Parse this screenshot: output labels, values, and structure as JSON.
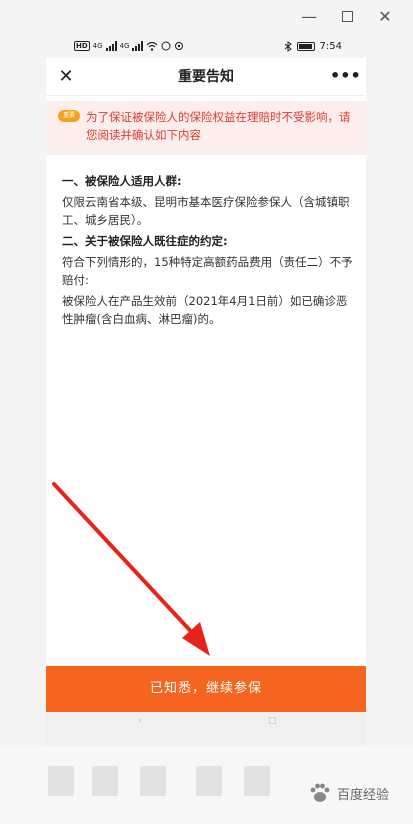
{
  "window": {
    "minimize_glyph": "—",
    "close_glyph": "✕"
  },
  "status_bar": {
    "network_badge": "HD",
    "signal_label_1": "4G",
    "signal_label_2": "4G",
    "time": "7:54"
  },
  "nav": {
    "title": "重要告知",
    "close_glyph": "✕",
    "more_glyph": "•••"
  },
  "notice": {
    "badge": "重要",
    "text": "为了保证被保险人的保险权益在理赔时不受影响，请您阅读并确认如下内容"
  },
  "content": {
    "section1_heading": "一、被保险人适用人群:",
    "section1_body": "仅限云南省本级、昆明市基本医疗保险参保人（含城镇职工、城乡居民）。",
    "section2_heading": "二、关于被保险人既往症的约定:",
    "section2_body1": "符合下列情形的，15种特定高额药品费用（责任二）不予赔付:",
    "section2_body2": "被保险人在产品生效前（2021年4月1日前）如已确诊恶性肿瘤(含白血病、淋巴瘤)的。"
  },
  "cta": {
    "label": "已知悉，继续参保"
  },
  "colors": {
    "accent": "#f5651f",
    "notice_text": "#e23b2e",
    "notice_bg": "#fdeeee",
    "badge": "#f5a21a"
  },
  "watermark": {
    "text": "百度经验"
  }
}
